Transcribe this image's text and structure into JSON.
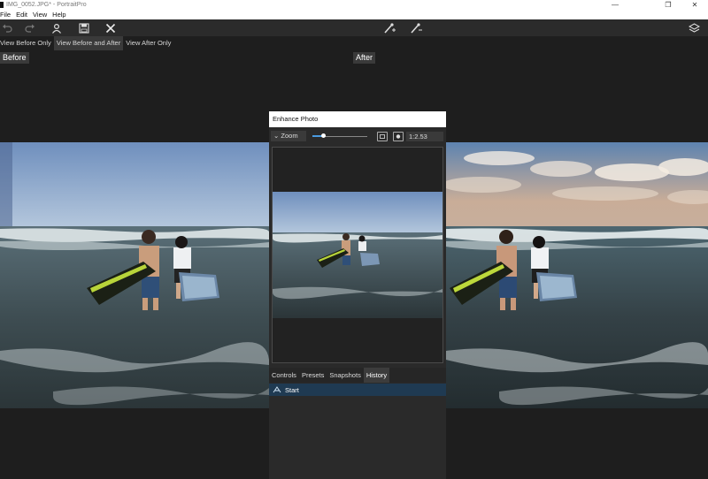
{
  "window": {
    "title": "IMG_0052.JPG* - PortraitPro",
    "controls": {
      "minimize": "—",
      "maximize": "❐",
      "close": "✕"
    }
  },
  "menu": {
    "items": [
      "File",
      "Edit",
      "View",
      "Help"
    ]
  },
  "toolbar": {
    "icons": [
      "undo-icon",
      "redo-icon",
      "person-icon",
      "save-icon",
      "close-icon",
      "brush-add-icon",
      "brush-remove-icon",
      "layers-icon"
    ]
  },
  "view_modes": {
    "before_only": "View Before Only",
    "before_and_after": "View Before and After",
    "after_only": "View After Only",
    "active": "before_and_after"
  },
  "labels": {
    "before": "Before",
    "after": "After"
  },
  "enhance": {
    "title": "Enhance Photo",
    "zoom_label": "Zoom",
    "zoom_level": 0.2,
    "ratio": "1:2.53",
    "tabs": [
      "Controls",
      "Presets",
      "Snapshots",
      "History"
    ],
    "active_tab": "History",
    "history": [
      "Start"
    ]
  },
  "colors": {
    "accent": "#4a9be0",
    "history_selected": "#1f3a52",
    "background": "#1e1e1e"
  }
}
